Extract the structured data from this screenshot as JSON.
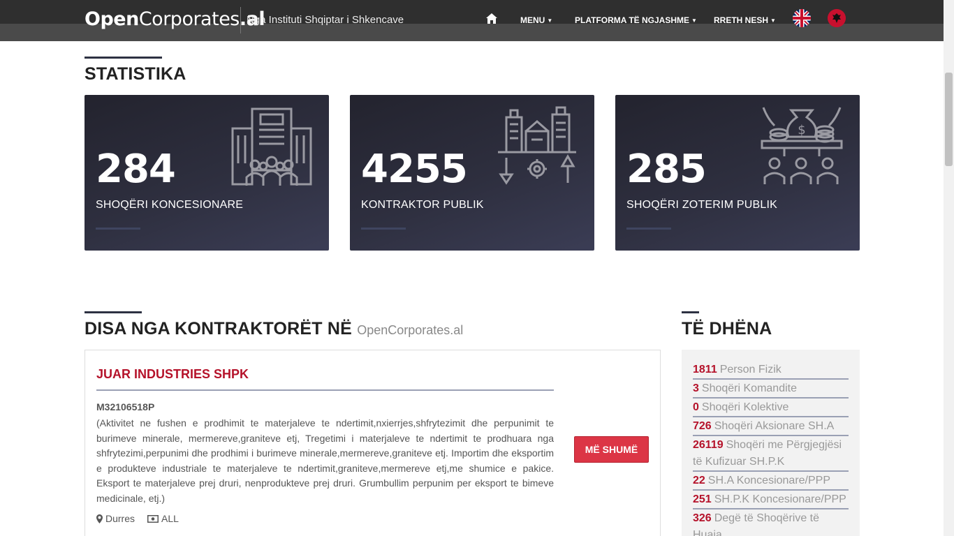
{
  "header": {
    "logo_bold": "Open",
    "logo_mid": "Corporates",
    "logo_tld": ".al",
    "tagline": "Nga Instituti Shqiptar i Shkencave",
    "home_icon": "home-icon",
    "nav": [
      {
        "label": "MENU"
      },
      {
        "label": "PLATFORMA TË NGJASHME"
      },
      {
        "label": "RRETH NESH"
      }
    ],
    "flags": [
      "uk-flag-icon",
      "albania-flag-icon"
    ]
  },
  "stats": {
    "title": "STATISTIKA",
    "cards": [
      {
        "value": "284",
        "label": "SHOQËRI KONCESIONARE",
        "icon": "buildings-people-icon"
      },
      {
        "value": "4255",
        "label": "KONTRAKTOR PUBLIK",
        "icon": "city-exchange-icon"
      },
      {
        "value": "285",
        "label": "SHOQËRI ZOTERIM PUBLIK",
        "icon": "money-people-icon"
      }
    ]
  },
  "contractors": {
    "title": "DISA NGA KONTRAKTORËT NË",
    "title_sub": "OpenCorporates.al",
    "item": {
      "name": "JUAR INDUSTRIES SHPK",
      "nipt": "M32106518P",
      "description": "(Aktivitet ne fushen e prodhimit te materjaleve te ndertimit,nxierrjes,shfrytezimit dhe perpunimit te burimeve minerale, mermereve,graniteve etj, Tregetimi i materjaleve te ndertimit te prodhuara nga shfrytezimi,perpunimi dhe prodhimi i burimeve minerale,mermereve,graniteve etj. Importim dhe eksportim e produkteve industriale te materjaleve te ndertimit,graniteve,mermereve etj,me shumice e pakice. Eksport te materjaleve prej druri, nenprodukteve prej druri. Grumbullim perpunim per eksport te bimeve medicinale, etj.)",
      "city": "Durres",
      "currency": "ALL",
      "more_label": "MË SHUMË"
    }
  },
  "data": {
    "title": "TË DHËNA",
    "items": [
      {
        "value": "1811",
        "label": "Person Fizik"
      },
      {
        "value": "3",
        "label": "Shoqëri Komandite"
      },
      {
        "value": "0",
        "label": "Shoqëri Kolektive"
      },
      {
        "value": "726",
        "label": "Shoqëri Aksionare SH.A"
      },
      {
        "value": "26119",
        "label": "Shoqëri me Përgjegjësi të Kufizuar SH.P.K"
      },
      {
        "value": "22",
        "label": "SH.A Koncesionare/PPP"
      },
      {
        "value": "251",
        "label": "SH.P.K Koncesionare/PPP"
      },
      {
        "value": "326",
        "label": "Degë të Shoqërive të Huaja"
      }
    ]
  },
  "colors": {
    "accent": "#b5122a",
    "button": "#dc3545",
    "card_bg": "#2e2f3f",
    "header": "#4a4a4a"
  }
}
